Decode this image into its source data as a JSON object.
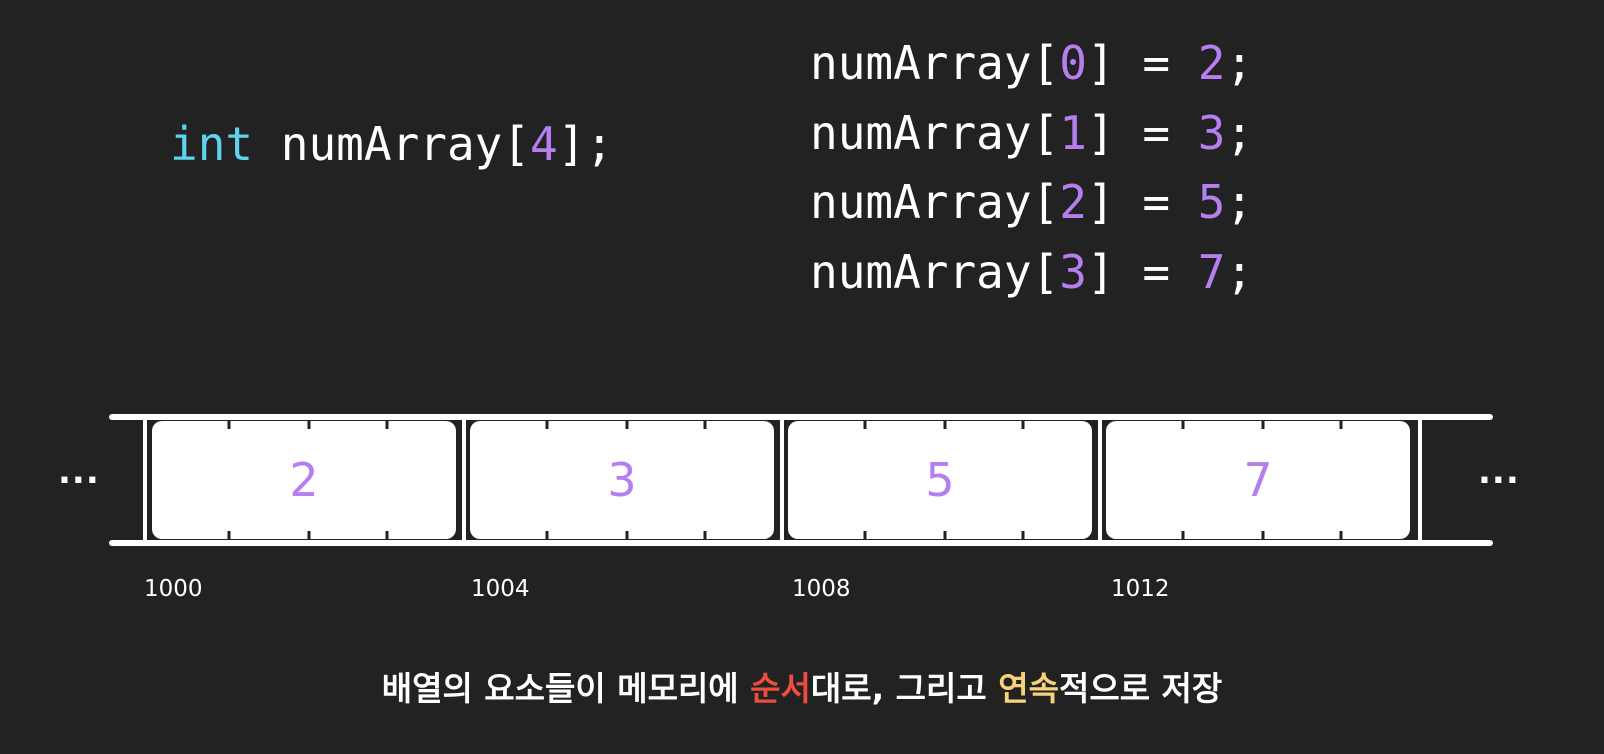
{
  "declaration": {
    "type_keyword": "int",
    "name": " numArray[",
    "size": "4",
    "close": "];"
  },
  "assignments": [
    {
      "lhs_open": "numArray[",
      "index": "0",
      "mid": "] = ",
      "value": "2",
      "end": ";"
    },
    {
      "lhs_open": "numArray[",
      "index": "1",
      "mid": "] = ",
      "value": "3",
      "end": ";"
    },
    {
      "lhs_open": "numArray[",
      "index": "2",
      "mid": "] = ",
      "value": "5",
      "end": ";"
    },
    {
      "lhs_open": "numArray[",
      "index": "3",
      "mid": "] = ",
      "value": "7",
      "end": ";"
    }
  ],
  "memory": {
    "ellipsis_left": "...",
    "ellipsis_right": "...",
    "cells": [
      "2",
      "3",
      "5",
      "7"
    ],
    "addresses": [
      "1000",
      "1004",
      "1008",
      "1012"
    ]
  },
  "caption": {
    "part1": "배열의 요소들이 메모리에 ",
    "highlight1": "순서",
    "part2": "대로, 그리고 ",
    "highlight2": "연속",
    "part3": "적으로 저장"
  },
  "colors": {
    "background": "#222222",
    "keyword": "#5fd3ee",
    "number": "#b57ff0",
    "highlight_red": "#ee4d3d",
    "highlight_yellow": "#f7d27a"
  }
}
